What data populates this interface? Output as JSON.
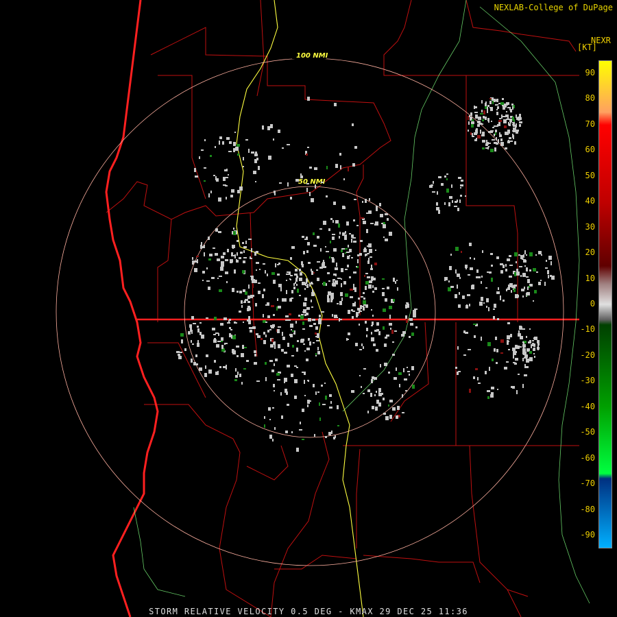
{
  "credit": "NEXLAB-College of DuPage",
  "product_code": "NEXR",
  "units": "[KT]",
  "footer": "STORM RELATIVE VELOCITY 0.5 DEG - KMAX 29 DEC 25 11:36",
  "range_rings": [
    {
      "label": "50 NMI"
    },
    {
      "label": "100 NMI"
    }
  ],
  "colorbar": {
    "ticks": [
      "90",
      "80",
      "70",
      "60",
      "50",
      "40",
      "30",
      "20",
      "10",
      "0",
      "-10",
      "-20",
      "-30",
      "-40",
      "-50",
      "-60",
      "-70",
      "-80",
      "-90"
    ],
    "range": [
      -95,
      95
    ],
    "stops": [
      {
        "value": 95,
        "color": "#ffff00"
      },
      {
        "value": 75,
        "color": "#ffa060"
      },
      {
        "value": 70,
        "color": "#ff0000"
      },
      {
        "value": 40,
        "color": "#c00000"
      },
      {
        "value": 15,
        "color": "#600000"
      },
      {
        "value": 8,
        "color": "#a08080"
      },
      {
        "value": 0,
        "color": "#e0e0e0"
      },
      {
        "value": -6,
        "color": "#606060"
      },
      {
        "value": -8,
        "color": "#004000"
      },
      {
        "value": -40,
        "color": "#00a000"
      },
      {
        "value": -66,
        "color": "#00ff40"
      },
      {
        "value": -68,
        "color": "#003080"
      },
      {
        "value": -95,
        "color": "#00b0ff"
      }
    ]
  },
  "colors": {
    "background": "#000000",
    "state_borders": "#ff3030",
    "county_borders": "#c01010",
    "highways": "#ffff40",
    "rivers": "#a0ffa0",
    "range_rings": "#ffb0a0",
    "echo": "#c8c8c8"
  }
}
